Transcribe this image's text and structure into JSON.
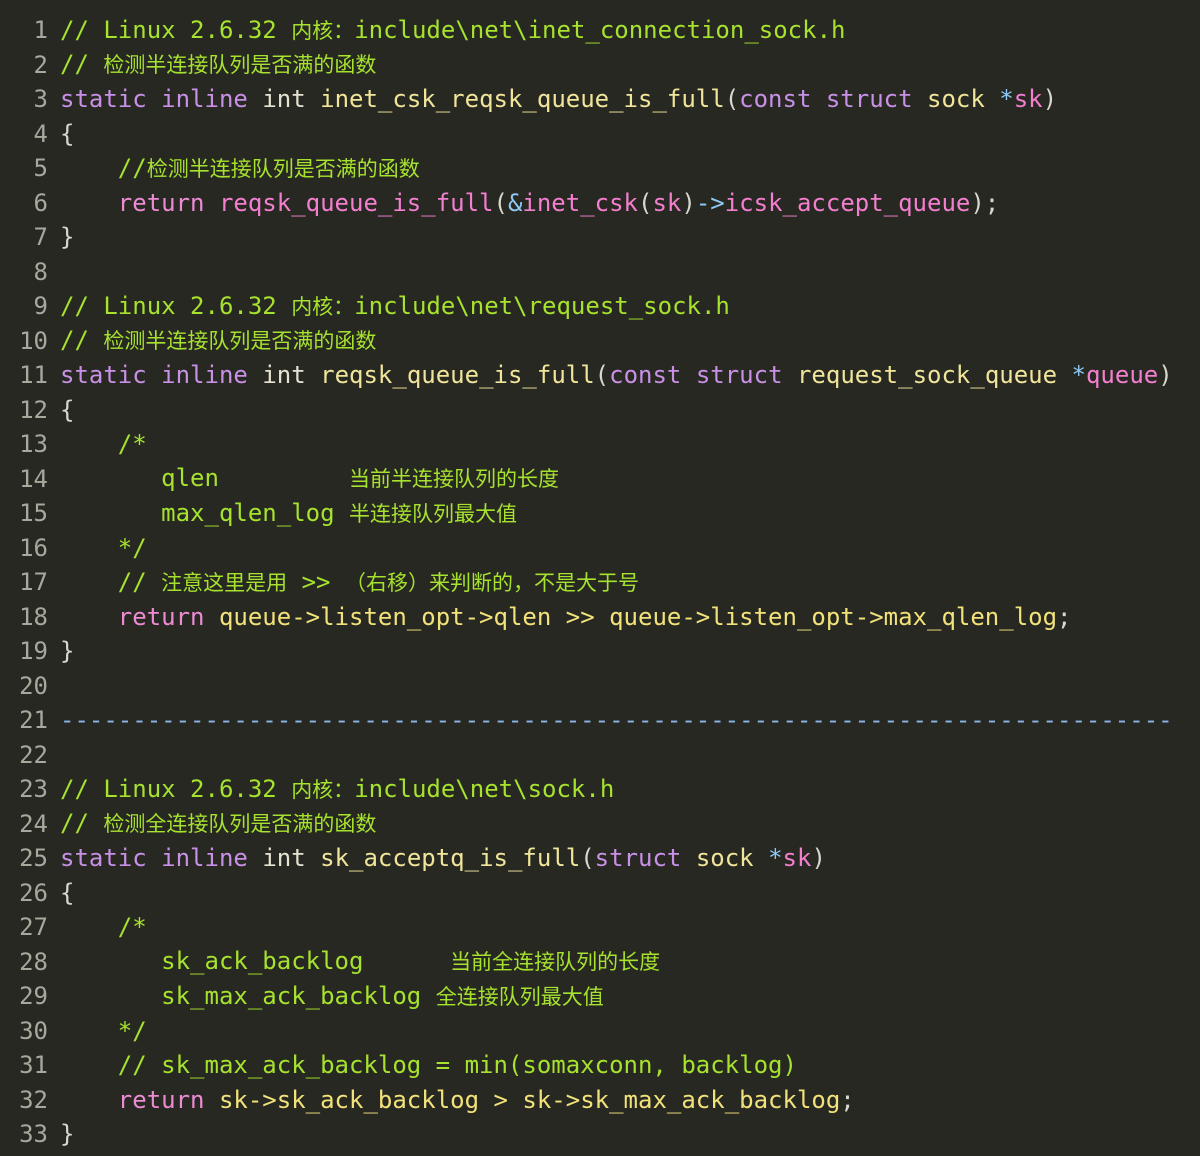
{
  "editor": {
    "lines": [
      {
        "n": "1",
        "tokens": [
          {
            "c": "t-comment",
            "t": "// Linux 2.6.32 "
          },
          {
            "c": "t-comment-cjk",
            "t": "内核："
          },
          {
            "c": "t-comment",
            "t": "include\\net\\inet_connection_sock.h"
          }
        ]
      },
      {
        "n": "2",
        "tokens": [
          {
            "c": "t-comment",
            "t": "// "
          },
          {
            "c": "t-comment-cjk",
            "t": "检测半连接队列是否满的函数"
          }
        ]
      },
      {
        "n": "3",
        "tokens": [
          {
            "c": "t-keyword",
            "t": "static"
          },
          {
            "c": "t-plain",
            "t": " "
          },
          {
            "c": "t-keyword",
            "t": "inline"
          },
          {
            "c": "t-plain",
            "t": " "
          },
          {
            "c": "t-type",
            "t": "int"
          },
          {
            "c": "t-plain",
            "t": " "
          },
          {
            "c": "t-fn",
            "t": "inet_csk_reqsk_queue_is_full"
          },
          {
            "c": "t-plain",
            "t": "("
          },
          {
            "c": "t-keyword",
            "t": "const"
          },
          {
            "c": "t-plain",
            "t": " "
          },
          {
            "c": "t-keyword",
            "t": "struct"
          },
          {
            "c": "t-plain",
            "t": " "
          },
          {
            "c": "t-fn",
            "t": "sock"
          },
          {
            "c": "t-plain",
            "t": " "
          },
          {
            "c": "t-blue",
            "t": "*"
          },
          {
            "c": "t-param",
            "t": "sk"
          },
          {
            "c": "t-plain",
            "t": ")"
          }
        ]
      },
      {
        "n": "4",
        "tokens": [
          {
            "c": "t-plain",
            "t": "{"
          }
        ]
      },
      {
        "n": "5",
        "tokens": [
          {
            "c": "t-plain",
            "t": "    "
          },
          {
            "c": "t-comment",
            "t": "//"
          },
          {
            "c": "t-comment-cjk",
            "t": "检测半连接队列是否满的函数"
          }
        ]
      },
      {
        "n": "6",
        "tokens": [
          {
            "c": "t-plain",
            "t": "    "
          },
          {
            "c": "t-ret",
            "t": "return"
          },
          {
            "c": "t-plain",
            "t": " "
          },
          {
            "c": "t-param",
            "t": "reqsk_queue_is_full"
          },
          {
            "c": "t-plain",
            "t": "("
          },
          {
            "c": "t-blue",
            "t": "&"
          },
          {
            "c": "t-param",
            "t": "inet_csk"
          },
          {
            "c": "t-plain",
            "t": "("
          },
          {
            "c": "t-param",
            "t": "sk"
          },
          {
            "c": "t-plain",
            "t": ")"
          },
          {
            "c": "t-blue",
            "t": "->"
          },
          {
            "c": "t-param",
            "t": "icsk_accept_queue"
          },
          {
            "c": "t-plain",
            "t": ");"
          }
        ]
      },
      {
        "n": "7",
        "tokens": [
          {
            "c": "t-plain",
            "t": "}"
          }
        ]
      },
      {
        "n": "8",
        "tokens": []
      },
      {
        "n": "9",
        "tokens": [
          {
            "c": "t-comment",
            "t": "// Linux 2.6.32 "
          },
          {
            "c": "t-comment-cjk",
            "t": "内核："
          },
          {
            "c": "t-comment",
            "t": "include\\net\\request_sock.h"
          }
        ]
      },
      {
        "n": "10",
        "tokens": [
          {
            "c": "t-comment",
            "t": "// "
          },
          {
            "c": "t-comment-cjk",
            "t": "检测半连接队列是否满的函数"
          }
        ]
      },
      {
        "n": "11",
        "tokens": [
          {
            "c": "t-keyword",
            "t": "static"
          },
          {
            "c": "t-plain",
            "t": " "
          },
          {
            "c": "t-keyword",
            "t": "inline"
          },
          {
            "c": "t-plain",
            "t": " "
          },
          {
            "c": "t-type",
            "t": "int"
          },
          {
            "c": "t-plain",
            "t": " "
          },
          {
            "c": "t-fn",
            "t": "reqsk_queue_is_full"
          },
          {
            "c": "t-plain",
            "t": "("
          },
          {
            "c": "t-keyword",
            "t": "const"
          },
          {
            "c": "t-plain",
            "t": " "
          },
          {
            "c": "t-keyword",
            "t": "struct"
          },
          {
            "c": "t-plain",
            "t": " "
          },
          {
            "c": "t-fn",
            "t": "request_sock_queue"
          },
          {
            "c": "t-plain",
            "t": " "
          },
          {
            "c": "t-blue",
            "t": "*"
          },
          {
            "c": "t-param",
            "t": "queue"
          },
          {
            "c": "t-plain",
            "t": ")"
          }
        ]
      },
      {
        "n": "12",
        "tokens": [
          {
            "c": "t-plain",
            "t": "{"
          }
        ]
      },
      {
        "n": "13",
        "tokens": [
          {
            "c": "t-plain",
            "t": "    "
          },
          {
            "c": "t-comment",
            "t": "/*"
          }
        ]
      },
      {
        "n": "14",
        "tokens": [
          {
            "c": "t-plain",
            "t": "       "
          },
          {
            "c": "t-comment",
            "t": "qlen         "
          },
          {
            "c": "t-comment-cjk",
            "t": "当前半连接队列的长度"
          }
        ]
      },
      {
        "n": "15",
        "tokens": [
          {
            "c": "t-plain",
            "t": "       "
          },
          {
            "c": "t-comment",
            "t": "max_qlen_log "
          },
          {
            "c": "t-comment-cjk",
            "t": "半连接队列最大值"
          }
        ]
      },
      {
        "n": "16",
        "tokens": [
          {
            "c": "t-plain",
            "t": "    "
          },
          {
            "c": "t-comment",
            "t": "*/"
          }
        ]
      },
      {
        "n": "17",
        "tokens": [
          {
            "c": "t-plain",
            "t": "    "
          },
          {
            "c": "t-comment",
            "t": "// "
          },
          {
            "c": "t-comment-cjk",
            "t": "注意这里是用"
          },
          {
            "c": "t-comment",
            "t": " >> "
          },
          {
            "c": "t-comment-cjk",
            "t": "（右移）来判断的，不是大于号"
          }
        ]
      },
      {
        "n": "18",
        "tokens": [
          {
            "c": "t-plain",
            "t": "    "
          },
          {
            "c": "t-ret",
            "t": "return"
          },
          {
            "c": "t-plain",
            "t": " "
          },
          {
            "c": "t-var",
            "t": "queue->listen_opt->qlen"
          },
          {
            "c": "t-plain",
            "t": " "
          },
          {
            "c": "t-var",
            "t": ">>"
          },
          {
            "c": "t-plain",
            "t": " "
          },
          {
            "c": "t-var",
            "t": "queue->listen_opt->max_qlen_log"
          },
          {
            "c": "t-plain",
            "t": ";"
          }
        ]
      },
      {
        "n": "19",
        "tokens": [
          {
            "c": "t-plain",
            "t": "}"
          }
        ]
      },
      {
        "n": "20",
        "tokens": []
      },
      {
        "n": "21",
        "tokens": [
          {
            "c": "t-sep",
            "t": "-----------------------------------------------------------------------------"
          }
        ]
      },
      {
        "n": "22",
        "tokens": []
      },
      {
        "n": "23",
        "tokens": [
          {
            "c": "t-comment",
            "t": "// Linux 2.6.32 "
          },
          {
            "c": "t-comment-cjk",
            "t": "内核："
          },
          {
            "c": "t-comment",
            "t": "include\\net\\sock.h"
          }
        ]
      },
      {
        "n": "24",
        "tokens": [
          {
            "c": "t-comment",
            "t": "// "
          },
          {
            "c": "t-comment-cjk",
            "t": "检测全连接队列是否满的函数"
          }
        ]
      },
      {
        "n": "25",
        "tokens": [
          {
            "c": "t-keyword",
            "t": "static"
          },
          {
            "c": "t-plain",
            "t": " "
          },
          {
            "c": "t-keyword",
            "t": "inline"
          },
          {
            "c": "t-plain",
            "t": " "
          },
          {
            "c": "t-type",
            "t": "int"
          },
          {
            "c": "t-plain",
            "t": " "
          },
          {
            "c": "t-fn",
            "t": "sk_acceptq_is_full"
          },
          {
            "c": "t-plain",
            "t": "("
          },
          {
            "c": "t-keyword",
            "t": "struct"
          },
          {
            "c": "t-plain",
            "t": " "
          },
          {
            "c": "t-fn",
            "t": "sock"
          },
          {
            "c": "t-plain",
            "t": " "
          },
          {
            "c": "t-blue",
            "t": "*"
          },
          {
            "c": "t-param",
            "t": "sk"
          },
          {
            "c": "t-plain",
            "t": ")"
          }
        ]
      },
      {
        "n": "26",
        "tokens": [
          {
            "c": "t-plain",
            "t": "{"
          }
        ]
      },
      {
        "n": "27",
        "tokens": [
          {
            "c": "t-plain",
            "t": "    "
          },
          {
            "c": "t-comment",
            "t": "/*"
          }
        ]
      },
      {
        "n": "28",
        "tokens": [
          {
            "c": "t-plain",
            "t": "       "
          },
          {
            "c": "t-comment",
            "t": "sk_ack_backlog      "
          },
          {
            "c": "t-comment-cjk",
            "t": "当前全连接队列的长度"
          }
        ]
      },
      {
        "n": "29",
        "tokens": [
          {
            "c": "t-plain",
            "t": "       "
          },
          {
            "c": "t-comment",
            "t": "sk_max_ack_backlog "
          },
          {
            "c": "t-comment-cjk",
            "t": "全连接队列最大值"
          }
        ]
      },
      {
        "n": "30",
        "tokens": [
          {
            "c": "t-plain",
            "t": "    "
          },
          {
            "c": "t-comment",
            "t": "*/"
          }
        ]
      },
      {
        "n": "31",
        "tokens": [
          {
            "c": "t-plain",
            "t": "    "
          },
          {
            "c": "t-comment",
            "t": "// sk_max_ack_backlog = min(somaxconn, backlog)"
          }
        ]
      },
      {
        "n": "32",
        "tokens": [
          {
            "c": "t-plain",
            "t": "    "
          },
          {
            "c": "t-ret",
            "t": "return"
          },
          {
            "c": "t-plain",
            "t": " "
          },
          {
            "c": "t-var",
            "t": "sk->sk_ack_backlog"
          },
          {
            "c": "t-plain",
            "t": " "
          },
          {
            "c": "t-var",
            "t": ">"
          },
          {
            "c": "t-plain",
            "t": " "
          },
          {
            "c": "t-var",
            "t": "sk->sk_max_ack_backlog"
          },
          {
            "c": "t-plain",
            "t": ";"
          }
        ]
      },
      {
        "n": "33",
        "tokens": [
          {
            "c": "t-plain",
            "t": "}"
          }
        ]
      }
    ]
  },
  "colors": {
    "background": "#272822",
    "comment": "#a6e22e",
    "keyword": "#c890e6",
    "return_keyword": "#ec8bd3",
    "function": "#f0e59a",
    "parameter": "#f47fd0",
    "variable": "#f2e27a",
    "operator": "#8ec9f5",
    "separator": "#8ab4e8",
    "line_number": "#a8a89c"
  }
}
